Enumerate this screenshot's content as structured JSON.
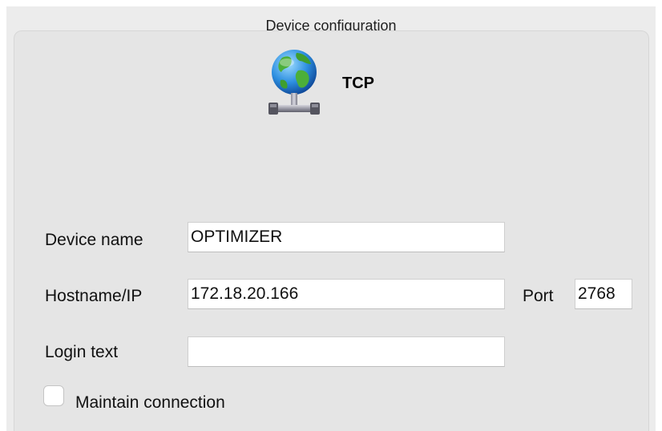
{
  "window": {
    "title": "Device configuration"
  },
  "device": {
    "type_label": "TCP",
    "icon": "network-globe-icon"
  },
  "fields": {
    "device_name": {
      "label": "Device name",
      "value": "OPTIMIZER"
    },
    "hostname": {
      "label": "Hostname/IP",
      "value": "172.18.20.166"
    },
    "port": {
      "label": "Port",
      "value": "2768"
    },
    "login_text": {
      "label": "Login text",
      "value": ""
    }
  },
  "options": {
    "maintain_connection": {
      "label": "Maintain connection",
      "checked": false
    }
  }
}
